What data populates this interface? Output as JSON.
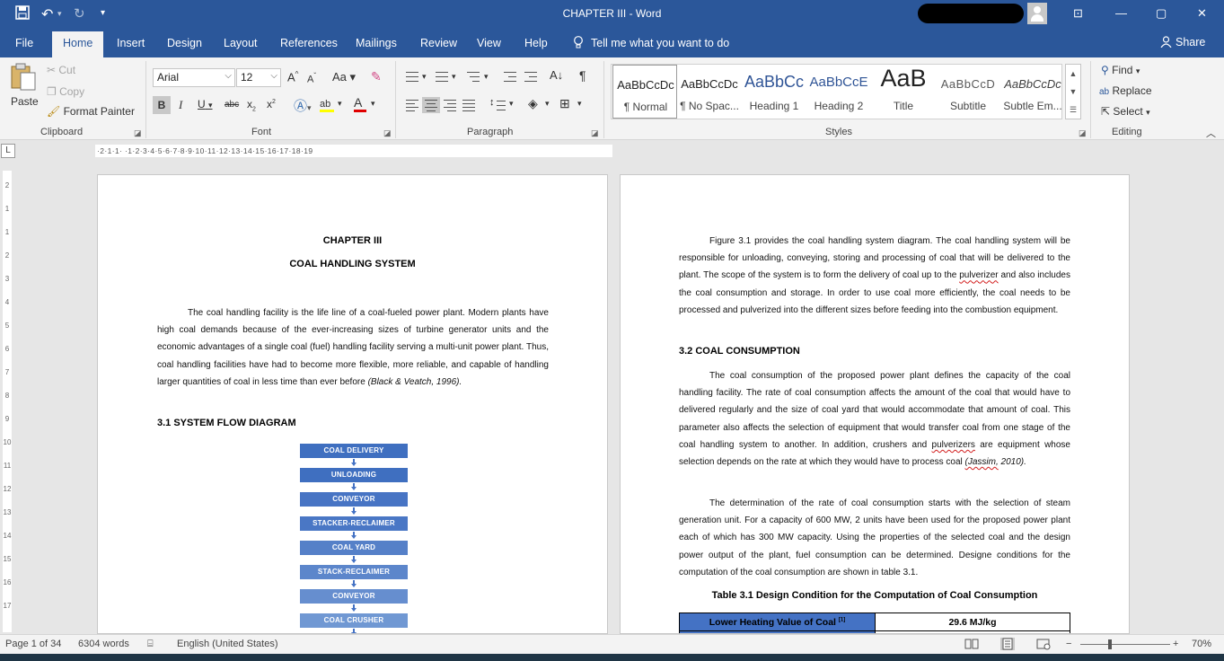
{
  "titlebar": {
    "title": "CHAPTER III  -  Word",
    "icons": [
      "save-icon",
      "undo-icon",
      "redo-icon",
      "customize-icon"
    ],
    "window": {
      "restore_ribbon": "⊡",
      "minimize": "—",
      "maximize": "▢",
      "close": "✕"
    }
  },
  "menu": {
    "tabs": [
      "File",
      "Home",
      "Insert",
      "Design",
      "Layout",
      "References",
      "Mailings",
      "Review",
      "View",
      "Help"
    ],
    "active": "Home",
    "tellme": "Tell me what you want to do",
    "share": "Share"
  },
  "ribbon": {
    "clipboard": {
      "paste": "Paste",
      "cut": "Cut",
      "copy": "Copy",
      "format_painter": "Format Painter",
      "label": "Clipboard"
    },
    "font": {
      "name": "Arial",
      "size": "12",
      "label": "Font",
      "grow": "A",
      "shrink": "A",
      "case": "Aa",
      "bold": "B",
      "italic": "I",
      "underline": "U",
      "strike": "abc",
      "sub": "x",
      "sup": "x"
    },
    "paragraph": {
      "label": "Paragraph"
    },
    "styles": {
      "label": "Styles",
      "items": [
        {
          "preview": "AaBbCcDc",
          "name": "¶ Normal"
        },
        {
          "preview": "AaBbCcDc",
          "name": "¶ No Spac..."
        },
        {
          "preview": "AaBbCc",
          "name": "Heading 1"
        },
        {
          "preview": "AaBbCcE",
          "name": "Heading 2"
        },
        {
          "preview": "AaB",
          "name": "Title"
        },
        {
          "preview": "AaBbCcD",
          "name": "Subtitle"
        },
        {
          "preview": "AaBbCcDc",
          "name": "Subtle Em..."
        }
      ]
    },
    "editing": {
      "find": "Find",
      "replace": "Replace",
      "select": "Select",
      "label": "Editing"
    }
  },
  "ruler": {
    "marks": "·2·1·1·  ·1·2·3·4·5·6·7·8·9·10·11·12·13·14·15·16·17·18·19"
  },
  "vruler": {
    "marks": [
      "2",
      "1",
      "1",
      "2",
      "3",
      "4",
      "5",
      "6",
      "7",
      "8",
      "9",
      "10",
      "11",
      "12",
      "13",
      "14",
      "15",
      "16",
      "17"
    ]
  },
  "page1": {
    "chapter": "CHAPTER III",
    "title": "COAL HANDLING SYSTEM",
    "intro": "The coal handling facility is the life line of a coal-fueled power plant. Modern plants have high coal demands because of the ever-increasing sizes of turbine generator units and the economic advantages of a single coal (fuel) handling facility serving a multi-unit power plant. Thus, coal handling facilities have had to become more flexible, more reliable, and capable of handling larger quantities of coal in less time than ever before ",
    "intro_cite": "(Black & Veatch, 1996).",
    "section": "3.1 SYSTEM FLOW DIAGRAM",
    "flow": [
      {
        "label": "COAL DELIVERY",
        "color": "#3f6fc0"
      },
      {
        "label": "UNLOADING",
        "color": "#3f6fc0"
      },
      {
        "label": "CONVEYOR",
        "color": "#4774c4"
      },
      {
        "label": "STACKER-RECLAIMER",
        "color": "#4a77c5"
      },
      {
        "label": "COAL YARD",
        "color": "#5580c8"
      },
      {
        "label": "STACK-RECLAIMER",
        "color": "#5c86cb"
      },
      {
        "label": "CONVEYOR",
        "color": "#668ecf"
      },
      {
        "label": "COAL CRUSHER",
        "color": "#7098d3"
      }
    ]
  },
  "page2": {
    "p1_a": "Figure 3.1 provides the coal handling system diagram. The coal handling system will be responsible for unloading, conveying, storing and processing of coal that will be delivered to the plant. The scope of the system is to form the delivery of coal up to the ",
    "p1_sq": "pulverizer",
    "p1_b": " and also includes the coal consumption and storage. In order to use coal more efficiently, the coal needs to be processed and pulverized into the different sizes before feeding into the combustion equipment.",
    "section": "3.2 COAL CONSUMPTION",
    "p2_a": "The coal consumption of the proposed power plant defines the capacity of the coal handling facility. The rate of coal consumption affects the amount of the coal that would have to delivered regularly and the size of coal yard that would accommodate that amount of coal. This parameter also affects the selection of equipment that would transfer coal from one stage of the coal handling system to another. In addition, crushers and ",
    "p2_sq": "pulverizers",
    "p2_b": " are equipment whose selection depends on the rate at which they would have to process coal ",
    "p2_cite_sq": "(Jassim,",
    "p2_cite": " 2010).",
    "p3": "The determination of the rate of coal consumption starts with the selection of steam generation unit. For a capacity of 600 MW, 2 units have been used for the proposed power plant each of which has 300 MW capacity. Using the properties of the selected coal and the design power output of the plant, fuel consumption can be determined. Designe conditions for the computation of the coal consumption are shown in table 3.1.",
    "table_caption": "Table 3.1 Design Condition for the Computation of Coal Consumption",
    "table": [
      {
        "label": "Lower Heating Value of Coal",
        "ref": "[1]",
        "value": "29.6 MJ/kg"
      }
    ]
  },
  "status": {
    "page": "Page 1 of 34",
    "words": "6304 words",
    "language": "English (United States)",
    "zoom": "70%",
    "minus": "−",
    "plus": "+"
  },
  "colors": {
    "accent": "#2b579a",
    "flow_blue": "#4472c4"
  }
}
